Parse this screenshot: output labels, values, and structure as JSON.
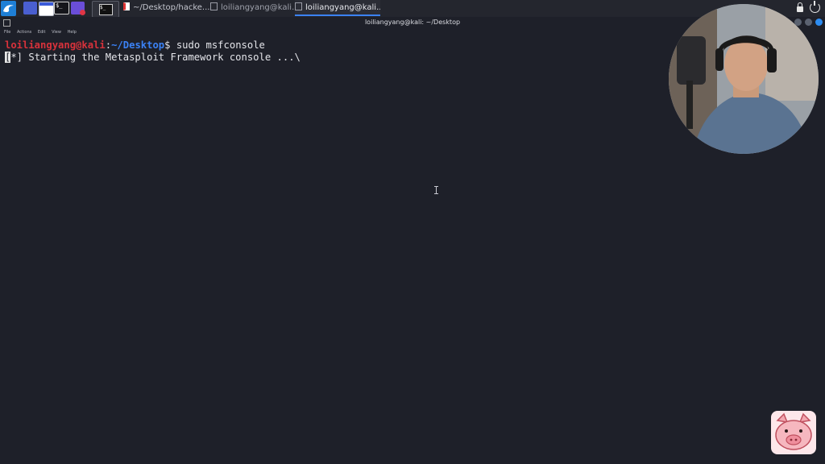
{
  "taskbar": {
    "tabs": [
      {
        "label": "~/Desktop/hacke..."
      },
      {
        "label": "loiliangyang@kali..."
      },
      {
        "label": "loiliangyang@kali..."
      }
    ],
    "active_tab_index": 2,
    "launcher_glyph": "$_"
  },
  "window": {
    "title": "loiliangyang@kali: ~/Desktop",
    "menu": [
      "File",
      "Actions",
      "Edit",
      "View",
      "Help"
    ]
  },
  "terminal": {
    "prompt_user_host": "loiliangyang@kali",
    "prompt_colon": ":",
    "prompt_path": "~/Desktop",
    "prompt_symbol": "$",
    "command": " sudo msfconsole",
    "status_bracket_open": "[",
    "status_rest": "*] Starting the Metasploit Framework console ...\\"
  },
  "colors": {
    "background": "#1e2029",
    "prompt_user": "#d8323b",
    "prompt_path": "#3b82f6",
    "accent": "#3b82f6"
  },
  "icons": [
    "kali-dragon-icon",
    "desktop-switcher-icon",
    "file-manager-icon",
    "terminal-icon",
    "screen-recorder-icon",
    "lock-icon",
    "power-icon",
    "ibeam-cursor-icon"
  ]
}
